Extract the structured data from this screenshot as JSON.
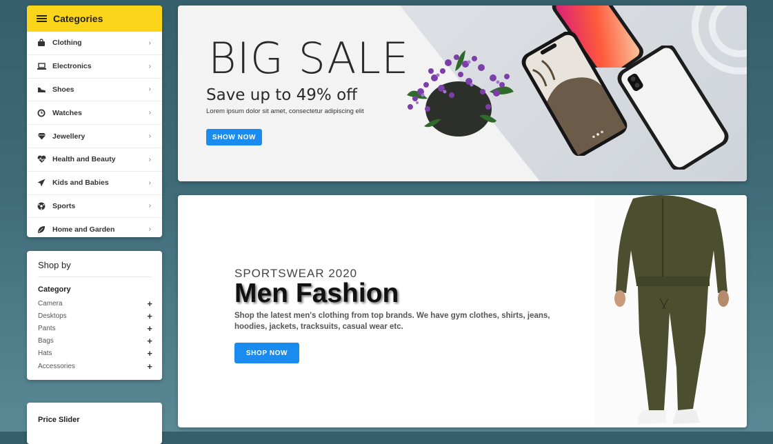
{
  "categories": {
    "title": "Categories",
    "items": [
      {
        "label": "Clothing",
        "icon": "bag-icon"
      },
      {
        "label": "Electronics",
        "icon": "laptop-icon"
      },
      {
        "label": "Shoes",
        "icon": "shoe-icon"
      },
      {
        "label": "Watches",
        "icon": "watch-icon"
      },
      {
        "label": "Jewellery",
        "icon": "gem-icon"
      },
      {
        "label": "Health and Beauty",
        "icon": "heart-pulse-icon"
      },
      {
        "label": "Kids and Babies",
        "icon": "paper-plane-icon"
      },
      {
        "label": "Sports",
        "icon": "ball-icon"
      },
      {
        "label": "Home and Garden",
        "icon": "leaf-icon"
      }
    ]
  },
  "shop_by": {
    "title": "Shop by",
    "category_title": "Category",
    "items": [
      "Camera",
      "Desktops",
      "Pants",
      "Bags",
      "Hats",
      "Accessories"
    ]
  },
  "price_slider": {
    "title": "Price Slider"
  },
  "banner_sale": {
    "title": "BIG SALE",
    "subtitle": "Save up to 49% off",
    "text": "Lorem ipsum dolor sit amet, consectetur adipiscing elit",
    "button": "SHOW NOW"
  },
  "banner_fashion": {
    "kicker": "SPORTSWEAR 2020",
    "title": "Men Fashion",
    "description": "Shop the latest men's clothing from top brands. We have gym clothes, shirts, jeans, hoodies, jackets, tracksuits, casual wear etc.",
    "button": "SHOP NOW"
  },
  "colors": {
    "accent_yellow": "#fbd51a",
    "button_blue": "#1a8cf0",
    "tracksuit_olive": "#4b4f30"
  }
}
